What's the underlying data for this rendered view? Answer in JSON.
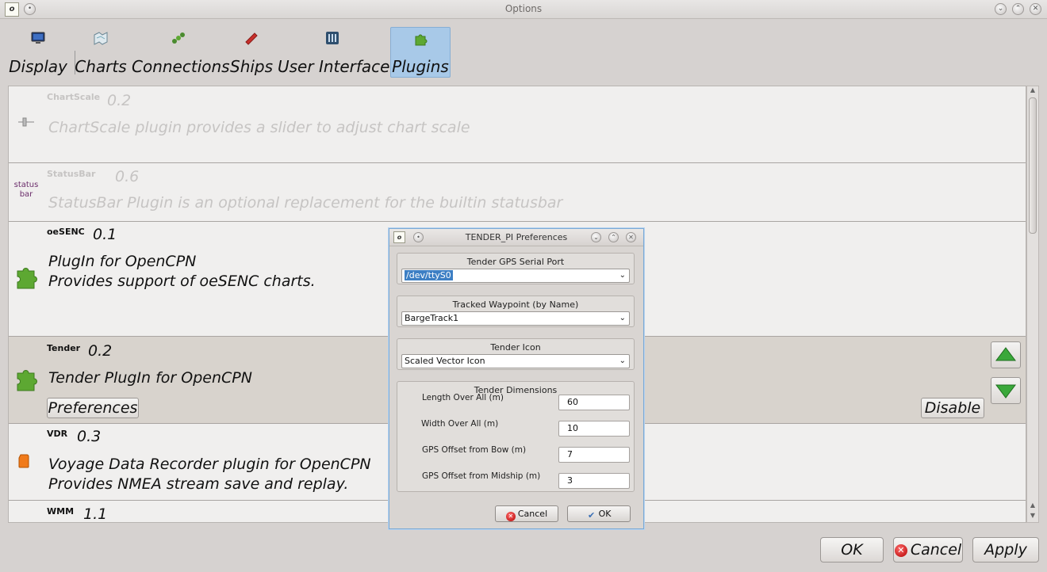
{
  "window": {
    "title": "Options"
  },
  "tabs": [
    {
      "label": "Display",
      "icon": "monitor-icon"
    },
    {
      "label": "Charts",
      "icon": "chart-map-icon"
    },
    {
      "label": "Connections",
      "icon": "connections-icon"
    },
    {
      "label": "Ships",
      "icon": "ship-icon"
    },
    {
      "label": "User Interface",
      "icon": "sliders-icon"
    },
    {
      "label": "Plugins",
      "icon": "puzzle-icon",
      "active": true
    }
  ],
  "plugins": [
    {
      "name": "ChartScale",
      "version": "0.2",
      "description": "ChartScale plugin provides a slider to adjust chart scale",
      "enabled": false
    },
    {
      "name": "StatusBar",
      "version": "0.6",
      "description": "StatusBar Plugin is an optional replacement for the builtin statusbar",
      "icon_text": "status\nbar",
      "enabled": false
    },
    {
      "name": "oeSENC",
      "version": "0.1",
      "description": "PlugIn for OpenCPN\nProvides support of oeSENC charts.",
      "enabled": true
    },
    {
      "name": "Tender",
      "version": "0.2",
      "description": "Tender PlugIn for OpenCPN",
      "enabled": true,
      "selected": true,
      "preferences_label": "Preferences",
      "disable_label": "Disable"
    },
    {
      "name": "VDR",
      "version": "0.3",
      "description": "Voyage Data Recorder plugin for OpenCPN\nProvides NMEA stream save and replay.",
      "enabled": true
    },
    {
      "name": "WMM",
      "version": "1.1",
      "description": "",
      "enabled": true
    }
  ],
  "buttons": {
    "ok": "OK",
    "cancel": "Cancel",
    "apply": "Apply"
  },
  "dialog": {
    "title": "TENDER_PI Preferences",
    "serial_port": {
      "label": "Tender GPS Serial Port",
      "value": "/dev/ttyS0"
    },
    "waypoint": {
      "label": "Tracked Waypoint (by Name)",
      "value": "BargeTrack1"
    },
    "icon": {
      "label": "Tender Icon",
      "value": "Scaled Vector Icon"
    },
    "dimensions": {
      "label": "Tender Dimensions",
      "fields": [
        {
          "label": "Length Over All (m)",
          "value": "60"
        },
        {
          "label": "Width Over All (m)",
          "value": "10"
        },
        {
          "label": "GPS Offset from Bow (m)",
          "value": "7"
        },
        {
          "label": "GPS Offset from Midship (m)",
          "value": "3"
        }
      ]
    },
    "cancel_label": "Cancel",
    "ok_label": "OK"
  },
  "colors": {
    "selection": "#a8c9e8",
    "puzzle_green": "#5da832",
    "dialog_border": "#7aa9d6"
  }
}
